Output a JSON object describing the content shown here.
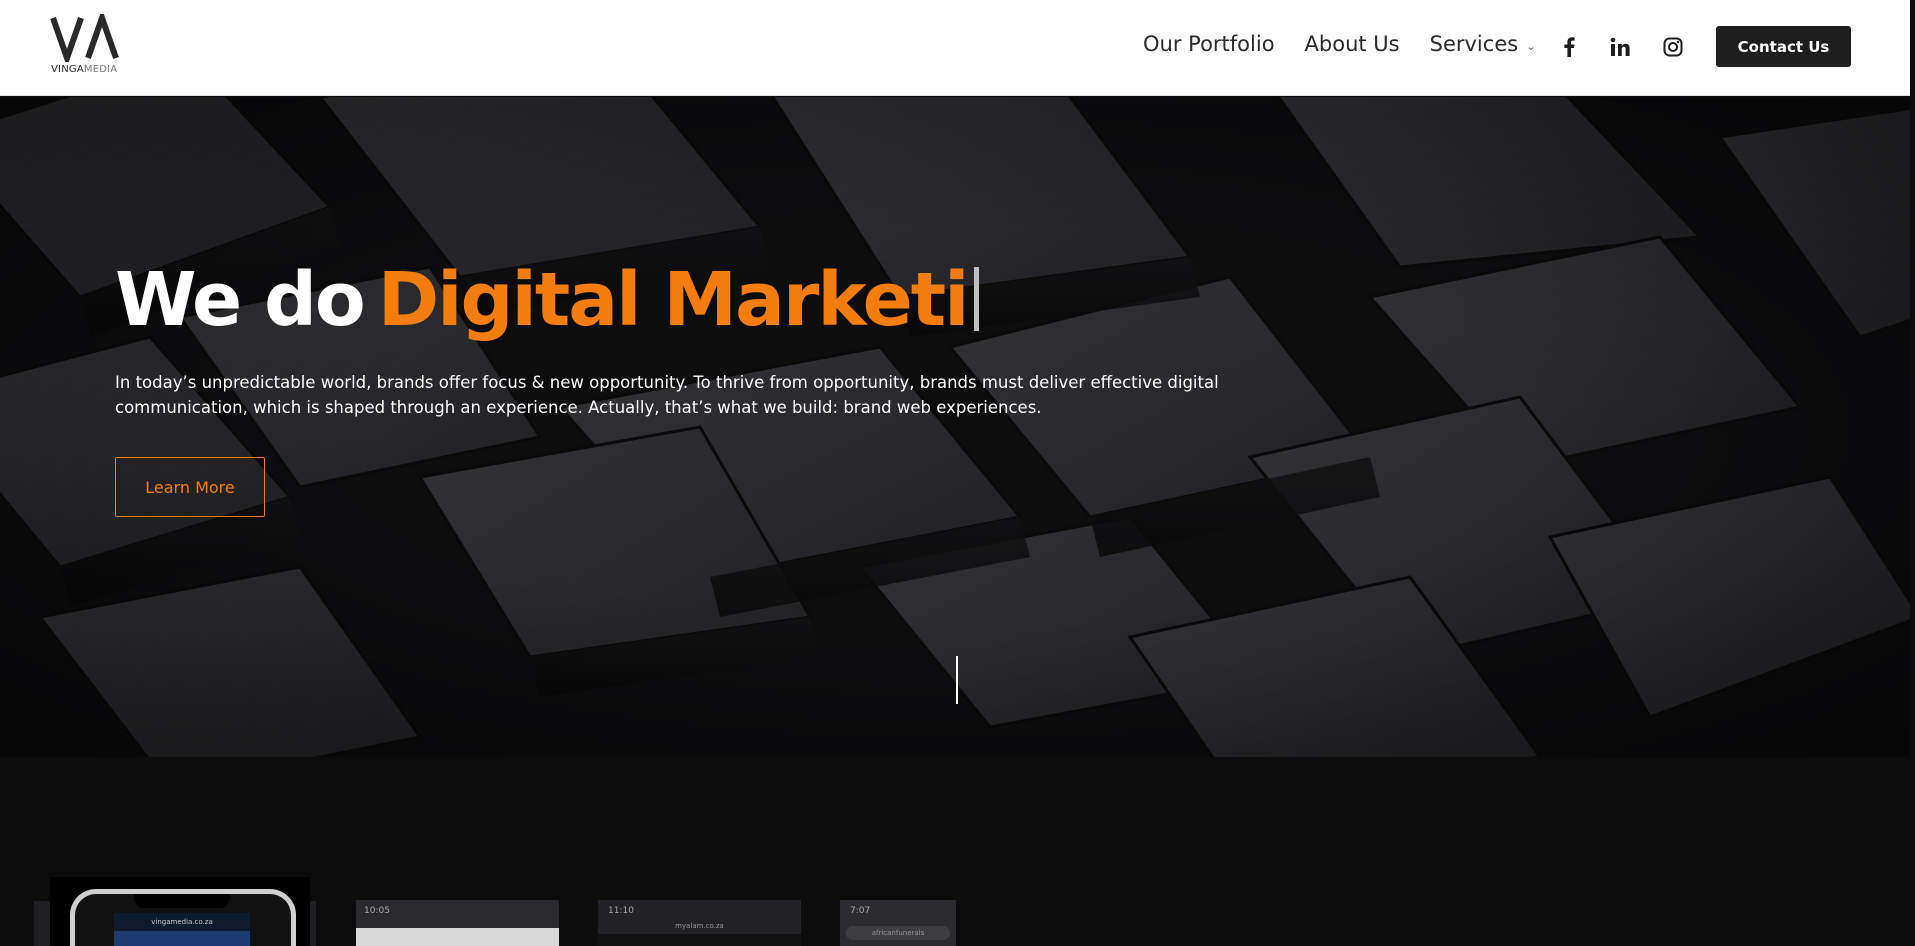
{
  "logo": {
    "brand_part1": "VINGA",
    "brand_part2": "MEDIA",
    "icon": "va-logo-icon"
  },
  "nav": {
    "items": [
      "Our Portfolio",
      "About Us",
      "Services"
    ],
    "services_chevron": "⌄",
    "social_icons": [
      "facebook-icon",
      "linkedin-icon",
      "instagram-icon"
    ],
    "contact_label": "Contact Us"
  },
  "hero": {
    "title_static": "We do",
    "title_typed": "Digital Marketi",
    "subtitle": "In today’s unpredictable world, brands offer focus & new opportunity. To thrive from opportunity, brands must deliver effective digital communication, which is shaped through an experience. Actually, that’s what we build: brand web experiences.",
    "button_label": "Learn More"
  },
  "portfolio": {
    "shot_urls": [
      "vingamedia.co.za",
      "myalam.co.za",
      "africanfunerals"
    ],
    "shot_times": [
      "10:05",
      "11:10",
      "7:07"
    ]
  },
  "colors": {
    "accent": "#f47d10",
    "header_bg": "#ffffff",
    "hero_text": "#ffffff",
    "button_dark": "#1e1e1e"
  }
}
